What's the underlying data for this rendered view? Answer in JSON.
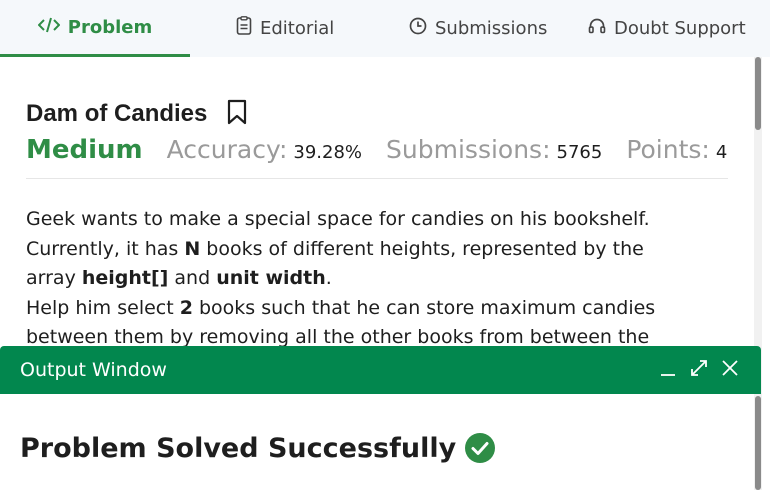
{
  "tabs": [
    {
      "label": "Problem",
      "icon": "code-icon"
    },
    {
      "label": "Editorial",
      "icon": "document-icon"
    },
    {
      "label": "Submissions",
      "icon": "clock-icon"
    },
    {
      "label": "Doubt Support",
      "icon": "headset-icon"
    }
  ],
  "problem": {
    "title": "Dam of Candies",
    "difficulty": "Medium",
    "accuracy_label": "Accuracy:",
    "accuracy_value": "39.28%",
    "submissions_label": "Submissions:",
    "submissions_value": "5765",
    "points_label": "Points:",
    "points_value": "4",
    "description": {
      "line1": "Geek wants to make a special space for candies on his bookshelf.",
      "line2_a": "Currently, it has ",
      "line2_b": "N",
      "line2_c": " books of different heights, represented by the",
      "line3_a": "array ",
      "line3_b": "height[]",
      "line3_c": " and ",
      "line3_d": "unit width",
      "line3_e": ".",
      "line4_a": "Help him select ",
      "line4_b": "2",
      "line4_c": " books such that he can store maximum candies",
      "line5": "between them by removing all the other books from between the"
    }
  },
  "output_window": {
    "title": "Output Window",
    "message": "Problem Solved Successfully"
  },
  "colors": {
    "accent": "#2f8d46",
    "output_header": "#02874e"
  }
}
